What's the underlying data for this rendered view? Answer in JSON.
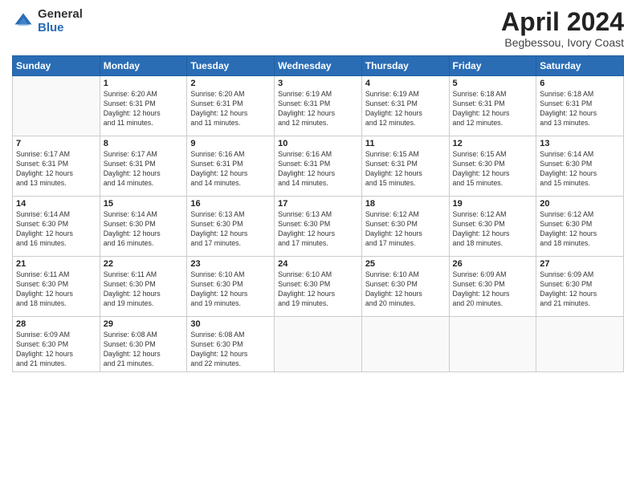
{
  "header": {
    "logo_general": "General",
    "logo_blue": "Blue",
    "title": "April 2024",
    "location": "Begbessou, Ivory Coast"
  },
  "days_of_week": [
    "Sunday",
    "Monday",
    "Tuesday",
    "Wednesday",
    "Thursday",
    "Friday",
    "Saturday"
  ],
  "weeks": [
    [
      {
        "day": "",
        "info": ""
      },
      {
        "day": "1",
        "info": "Sunrise: 6:20 AM\nSunset: 6:31 PM\nDaylight: 12 hours\nand 11 minutes."
      },
      {
        "day": "2",
        "info": "Sunrise: 6:20 AM\nSunset: 6:31 PM\nDaylight: 12 hours\nand 11 minutes."
      },
      {
        "day": "3",
        "info": "Sunrise: 6:19 AM\nSunset: 6:31 PM\nDaylight: 12 hours\nand 12 minutes."
      },
      {
        "day": "4",
        "info": "Sunrise: 6:19 AM\nSunset: 6:31 PM\nDaylight: 12 hours\nand 12 minutes."
      },
      {
        "day": "5",
        "info": "Sunrise: 6:18 AM\nSunset: 6:31 PM\nDaylight: 12 hours\nand 12 minutes."
      },
      {
        "day": "6",
        "info": "Sunrise: 6:18 AM\nSunset: 6:31 PM\nDaylight: 12 hours\nand 13 minutes."
      }
    ],
    [
      {
        "day": "7",
        "info": "Sunrise: 6:17 AM\nSunset: 6:31 PM\nDaylight: 12 hours\nand 13 minutes."
      },
      {
        "day": "8",
        "info": "Sunrise: 6:17 AM\nSunset: 6:31 PM\nDaylight: 12 hours\nand 14 minutes."
      },
      {
        "day": "9",
        "info": "Sunrise: 6:16 AM\nSunset: 6:31 PM\nDaylight: 12 hours\nand 14 minutes."
      },
      {
        "day": "10",
        "info": "Sunrise: 6:16 AM\nSunset: 6:31 PM\nDaylight: 12 hours\nand 14 minutes."
      },
      {
        "day": "11",
        "info": "Sunrise: 6:15 AM\nSunset: 6:31 PM\nDaylight: 12 hours\nand 15 minutes."
      },
      {
        "day": "12",
        "info": "Sunrise: 6:15 AM\nSunset: 6:30 PM\nDaylight: 12 hours\nand 15 minutes."
      },
      {
        "day": "13",
        "info": "Sunrise: 6:14 AM\nSunset: 6:30 PM\nDaylight: 12 hours\nand 15 minutes."
      }
    ],
    [
      {
        "day": "14",
        "info": "Sunrise: 6:14 AM\nSunset: 6:30 PM\nDaylight: 12 hours\nand 16 minutes."
      },
      {
        "day": "15",
        "info": "Sunrise: 6:14 AM\nSunset: 6:30 PM\nDaylight: 12 hours\nand 16 minutes."
      },
      {
        "day": "16",
        "info": "Sunrise: 6:13 AM\nSunset: 6:30 PM\nDaylight: 12 hours\nand 17 minutes."
      },
      {
        "day": "17",
        "info": "Sunrise: 6:13 AM\nSunset: 6:30 PM\nDaylight: 12 hours\nand 17 minutes."
      },
      {
        "day": "18",
        "info": "Sunrise: 6:12 AM\nSunset: 6:30 PM\nDaylight: 12 hours\nand 17 minutes."
      },
      {
        "day": "19",
        "info": "Sunrise: 6:12 AM\nSunset: 6:30 PM\nDaylight: 12 hours\nand 18 minutes."
      },
      {
        "day": "20",
        "info": "Sunrise: 6:12 AM\nSunset: 6:30 PM\nDaylight: 12 hours\nand 18 minutes."
      }
    ],
    [
      {
        "day": "21",
        "info": "Sunrise: 6:11 AM\nSunset: 6:30 PM\nDaylight: 12 hours\nand 18 minutes."
      },
      {
        "day": "22",
        "info": "Sunrise: 6:11 AM\nSunset: 6:30 PM\nDaylight: 12 hours\nand 19 minutes."
      },
      {
        "day": "23",
        "info": "Sunrise: 6:10 AM\nSunset: 6:30 PM\nDaylight: 12 hours\nand 19 minutes."
      },
      {
        "day": "24",
        "info": "Sunrise: 6:10 AM\nSunset: 6:30 PM\nDaylight: 12 hours\nand 19 minutes."
      },
      {
        "day": "25",
        "info": "Sunrise: 6:10 AM\nSunset: 6:30 PM\nDaylight: 12 hours\nand 20 minutes."
      },
      {
        "day": "26",
        "info": "Sunrise: 6:09 AM\nSunset: 6:30 PM\nDaylight: 12 hours\nand 20 minutes."
      },
      {
        "day": "27",
        "info": "Sunrise: 6:09 AM\nSunset: 6:30 PM\nDaylight: 12 hours\nand 21 minutes."
      }
    ],
    [
      {
        "day": "28",
        "info": "Sunrise: 6:09 AM\nSunset: 6:30 PM\nDaylight: 12 hours\nand 21 minutes."
      },
      {
        "day": "29",
        "info": "Sunrise: 6:08 AM\nSunset: 6:30 PM\nDaylight: 12 hours\nand 21 minutes."
      },
      {
        "day": "30",
        "info": "Sunrise: 6:08 AM\nSunset: 6:30 PM\nDaylight: 12 hours\nand 22 minutes."
      },
      {
        "day": "",
        "info": ""
      },
      {
        "day": "",
        "info": ""
      },
      {
        "day": "",
        "info": ""
      },
      {
        "day": "",
        "info": ""
      }
    ]
  ]
}
